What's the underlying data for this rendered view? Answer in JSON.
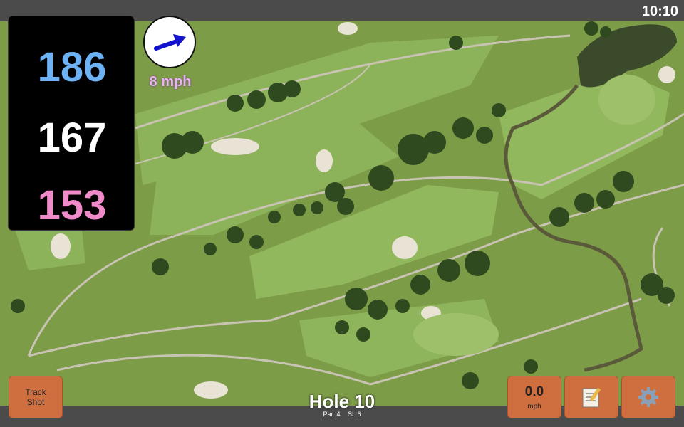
{
  "status_bar": {
    "time": "10:10"
  },
  "distances": {
    "back": "186",
    "middle": "167",
    "front": "153"
  },
  "wind": {
    "speed_label": "8 mph",
    "direction_icon": "arrow-icon"
  },
  "buttons": {
    "track_shot": "Track\nShot",
    "wind_value": "0.0",
    "wind_unit": "mph",
    "notes_icon": "notepad-icon",
    "settings_icon": "gear-icon"
  },
  "hole": {
    "title": "Hole 10",
    "par": "Par: 4",
    "si": "SI: 6"
  },
  "colors": {
    "back": "#6cb2f4",
    "middle": "#ffffff",
    "front": "#f08ac9",
    "button": "#cf6f40"
  }
}
